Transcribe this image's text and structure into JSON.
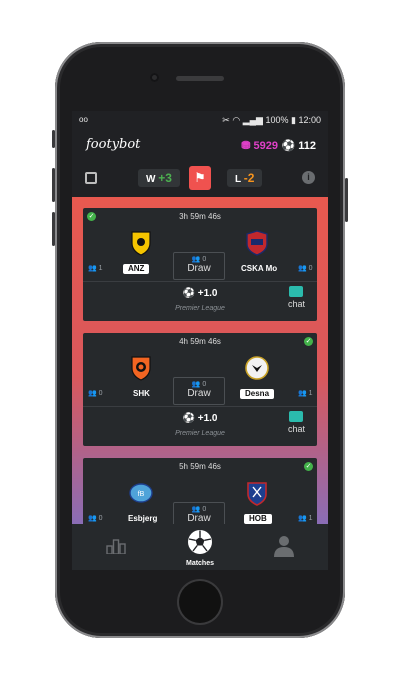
{
  "status_bar": {
    "left": "oo",
    "battery": "100%",
    "time": "12:00"
  },
  "app": {
    "logo": "footybot",
    "coins": "5929",
    "balls": "112"
  },
  "toolbar": {
    "wins_prefix": "W",
    "wins_value": "+3",
    "losses_prefix": "L",
    "losses_value": "-2"
  },
  "matches": [
    {
      "timer": "3h 59m 46s",
      "home": {
        "name": "ANZ",
        "count": "1"
      },
      "away": {
        "name": "CSKA Mo",
        "count": "0"
      },
      "draw_count": "0",
      "draw_label": "Draw",
      "bet": "+1.0",
      "league": "Premier League",
      "chat": "chat"
    },
    {
      "timer": "4h 59m 46s",
      "home": {
        "name": "SHK",
        "count": "0"
      },
      "away": {
        "name": "Desna",
        "count": "1"
      },
      "draw_count": "0",
      "draw_label": "Draw",
      "bet": "+1.0",
      "league": "Premier League",
      "chat": "chat"
    },
    {
      "timer": "5h 59m 46s",
      "home": {
        "name": "Esbjerg",
        "count": "0"
      },
      "away": {
        "name": "HOB",
        "count": "1"
      },
      "draw_count": "0",
      "draw_label": "Draw"
    }
  ],
  "nav": {
    "matches_label": "Matches"
  },
  "icons": [
    "calendar-icon",
    "info-icon",
    "leaderboard-icon",
    "soccer-ball-icon",
    "profile-icon",
    "chat-icon",
    "check-icon"
  ],
  "colors": {
    "accent_red": "#e8594f",
    "coins_magenta": "#e040c8",
    "win_green": "#4caf50",
    "loss_orange": "#f7941d",
    "chat_teal": "#2bbbad",
    "check_green": "#43b24a"
  }
}
